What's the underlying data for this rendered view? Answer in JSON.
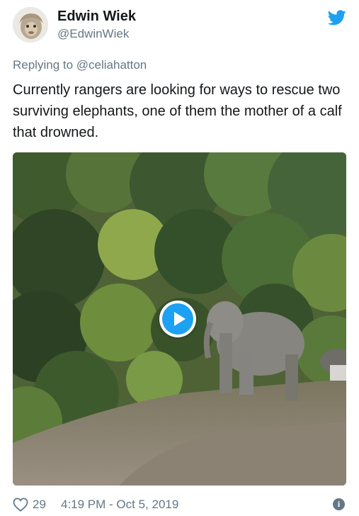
{
  "author": {
    "name": "Edwin Wiek",
    "handle": "@EdwinWiek"
  },
  "reply": {
    "prefix": "Replying to ",
    "mention": "@celiahatton"
  },
  "tweet": {
    "text": "Currently rangers are looking for ways to rescue two surviving elephants, one of them the mother of a calf that drowned."
  },
  "media": {
    "type": "video",
    "play_icon": "play-icon"
  },
  "footer": {
    "likes": "29",
    "timestamp": "4:19 PM - Oct 5, 2019"
  },
  "icons": {
    "brand": "twitter-bird-icon",
    "like": "heart-icon",
    "info": "info-icon"
  },
  "colors": {
    "brand": "#1da1f2",
    "text": "#14171a",
    "muted": "#657786"
  }
}
